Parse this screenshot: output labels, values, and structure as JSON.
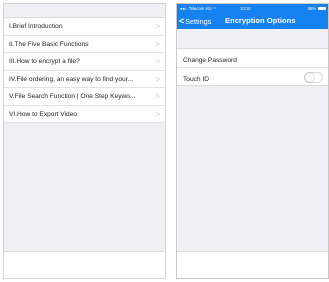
{
  "help_list": {
    "items": [
      {
        "label": "I.Brief Introduction"
      },
      {
        "label": "II.The Five Basic Functions"
      },
      {
        "label": "III.How to encrypt a file?"
      },
      {
        "label": "IV.File ordering, an easy way to find your..."
      },
      {
        "label": "V.File Search Function | One Step Keywo..."
      },
      {
        "label": "VI.How to Export Video"
      }
    ],
    "chevron": ">"
  },
  "status_bar": {
    "carrier": "Telecom HU",
    "time": "10:10",
    "battery": "88%"
  },
  "nav_bar": {
    "back_label": "Settings",
    "back_chevron": "<",
    "title": "Encryption Options",
    "color": "#1682f0"
  },
  "settings": {
    "change_password": "Change Password",
    "touch_id": "Touch ID",
    "touch_id_enabled": false
  }
}
